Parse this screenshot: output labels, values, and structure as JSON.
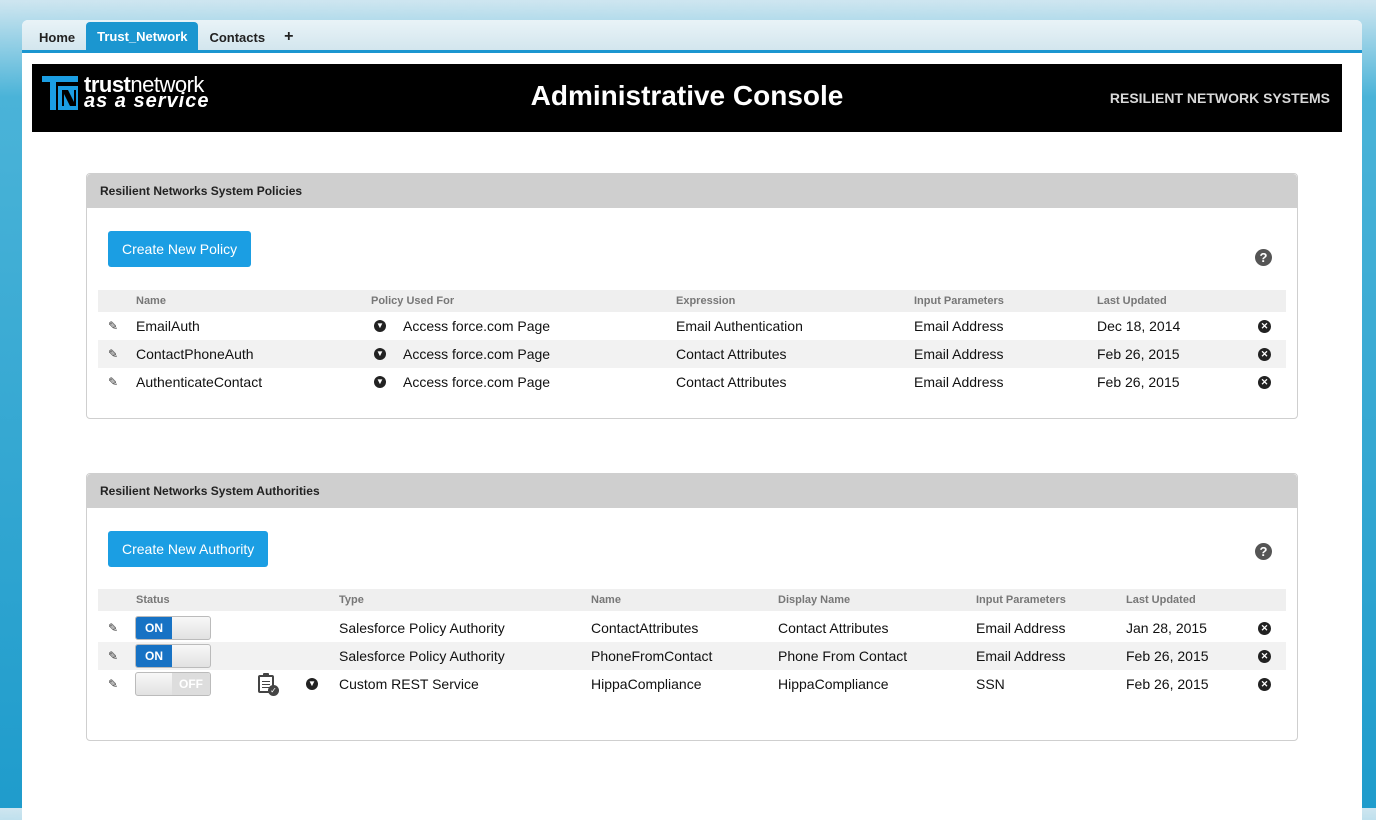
{
  "tabs": [
    {
      "label": "Home"
    },
    {
      "label": "Trust_Network"
    },
    {
      "label": "Contacts"
    },
    {
      "label": "+"
    }
  ],
  "banner": {
    "logo_line1_bold": "trust",
    "logo_line1_rest": "network",
    "logo_line2": "as a service",
    "title": "Administrative Console",
    "right_text": "RESILIENT NETWORK SYSTEMS"
  },
  "policies": {
    "heading": "Resilient Networks System Policies",
    "create_button": "Create New Policy",
    "help": "?",
    "columns": [
      "Name",
      "Policy Used For",
      "Expression",
      "Input Parameters",
      "Last Updated"
    ],
    "rows": [
      {
        "name": "EmailAuth",
        "used_for": "Access force.com Page",
        "expression": "Email Authentication",
        "input": "Email Address",
        "updated": "Dec 18, 2014"
      },
      {
        "name": "ContactPhoneAuth",
        "used_for": "Access force.com Page",
        "expression": "Contact Attributes",
        "input": "Email Address",
        "updated": "Feb 26, 2015"
      },
      {
        "name": "AuthenticateContact",
        "used_for": "Access force.com Page",
        "expression": "Contact Attributes",
        "input": "Email Address",
        "updated": "Feb 26, 2015"
      }
    ]
  },
  "authorities": {
    "heading": "Resilient Networks System Authorities",
    "create_button": "Create New Authority",
    "help": "?",
    "columns": [
      "Status",
      "Type",
      "Name",
      "Display Name",
      "Input Parameters",
      "Last Updated"
    ],
    "rows": [
      {
        "status": "ON",
        "type": "Salesforce Policy Authority",
        "name": "ContactAttributes",
        "display": "Contact Attributes",
        "input": "Email Address",
        "updated": "Jan 28, 2015"
      },
      {
        "status": "ON",
        "type": "Salesforce Policy Authority",
        "name": "PhoneFromContact",
        "display": "Phone From Contact",
        "input": "Email Address",
        "updated": "Feb 26, 2015"
      },
      {
        "status": "OFF",
        "type": "Custom REST Service",
        "name": "HippaCompliance",
        "display": "HippaCompliance",
        "input": "SSN",
        "updated": "Feb 26, 2015"
      }
    ]
  },
  "colors": {
    "accent": "#1b96d0",
    "button": "#1b9ee3",
    "toggle_on": "#1772c4"
  }
}
